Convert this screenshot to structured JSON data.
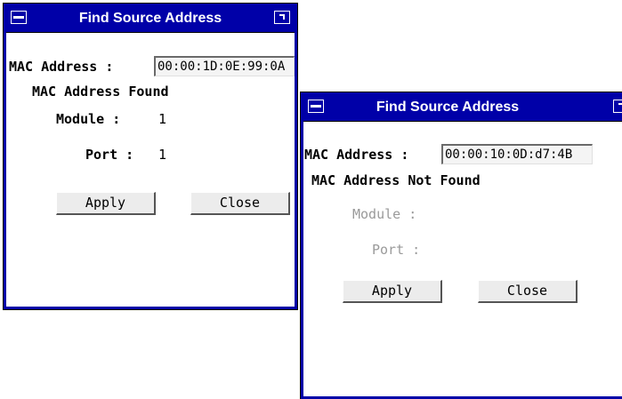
{
  "window1": {
    "title": "Find Source Address",
    "mac_label": "MAC Address :",
    "mac_value": "00:00:1D:0E:99:0A",
    "status": "MAC Address Found",
    "module_label": "Module :",
    "module_value": "1",
    "port_label": "Port :",
    "port_value": "1",
    "apply_label": "Apply",
    "close_label": "Close"
  },
  "window2": {
    "title": "Find Source Address",
    "mac_label": "MAC Address :",
    "mac_value": "00:00:10:0D:d7:4B",
    "status": "MAC Address Not Found",
    "module_label": "Module :",
    "port_label": "Port :",
    "apply_label": "Apply",
    "close_label": "Close"
  },
  "colors": {
    "titlebar": "#0000a8",
    "title_text": "#ffffff",
    "disabled_text": "#9a9a9a"
  },
  "icons": [
    "system-menu-icon",
    "maximize-icon"
  ]
}
